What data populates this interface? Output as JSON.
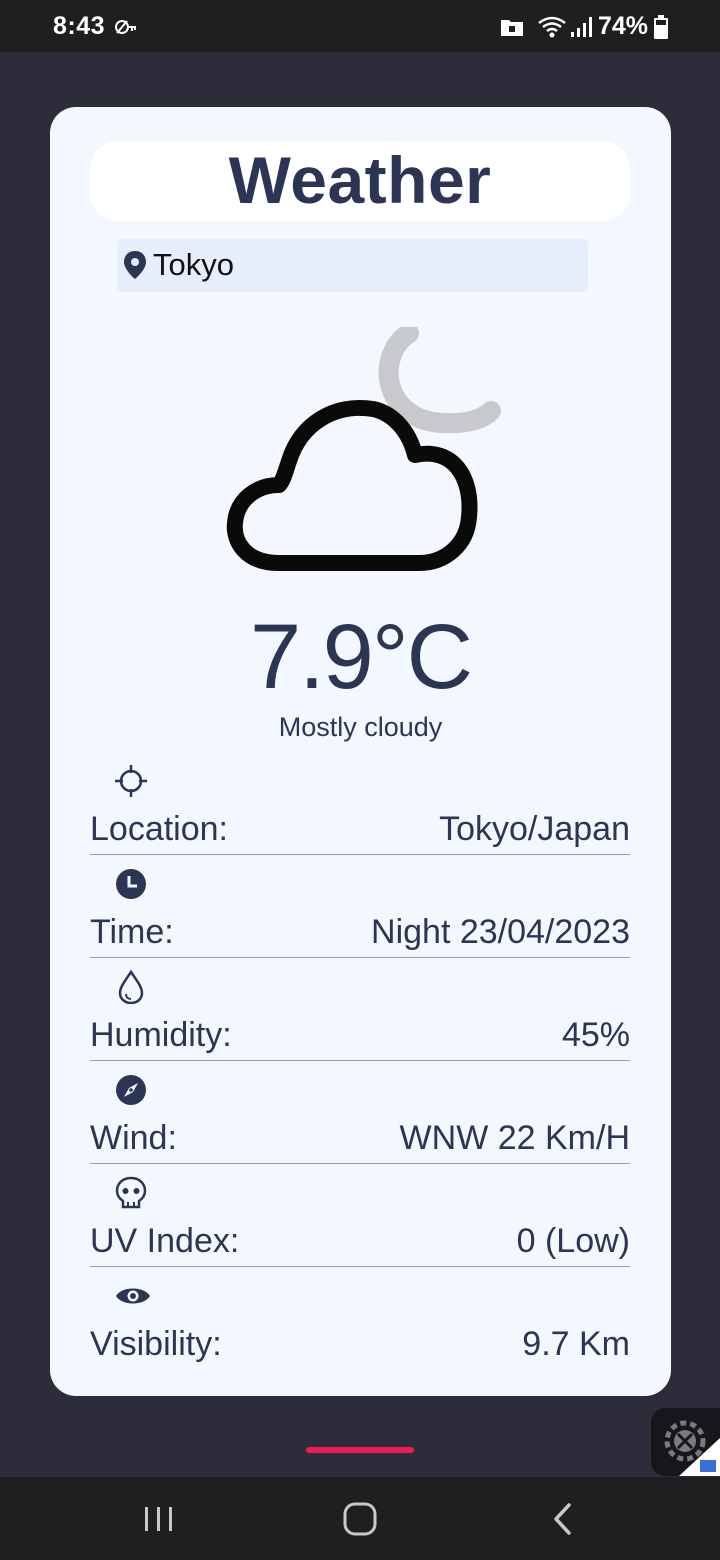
{
  "status_bar": {
    "time": "8:43",
    "battery": "74%",
    "icons": [
      "vpn-key-icon",
      "folder-lock-icon",
      "wifi-icon",
      "signal-icon",
      "battery-icon"
    ]
  },
  "app": {
    "title": "Weather",
    "search": {
      "value": "Tokyo"
    },
    "current": {
      "icon": "cloud-moon-icon",
      "temperature": "7.9°C",
      "condition": "Mostly cloudy"
    },
    "details": [
      {
        "icon": "crosshair-icon",
        "label": "Location:",
        "value": "Tokyo/Japan"
      },
      {
        "icon": "clock-icon",
        "label": "Time:",
        "value": "Night 23/04/2023"
      },
      {
        "icon": "droplet-icon",
        "label": "Humidity:",
        "value": "45%"
      },
      {
        "icon": "compass-icon",
        "label": "Wind:",
        "value": "WNW 22 Km/H"
      },
      {
        "icon": "skull-icon",
        "label": "UV Index:",
        "value": "0 (Low)"
      },
      {
        "icon": "eye-icon",
        "label": "Visibility:",
        "value": "9.7 Km"
      }
    ]
  },
  "colors": {
    "background": "#2d2c3a",
    "card": "#f3f7fe",
    "text": "#2d3554",
    "accent": "#ef1a57"
  },
  "nav_bar": {
    "buttons": [
      "recent-apps-button",
      "home-button",
      "back-button"
    ]
  }
}
